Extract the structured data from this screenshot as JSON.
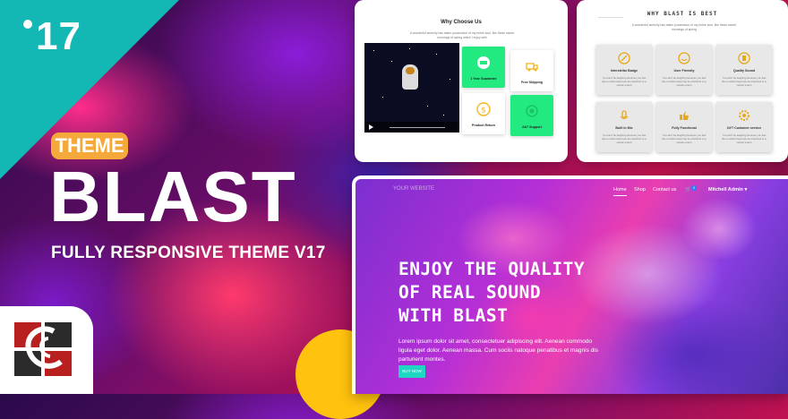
{
  "badge": {
    "version": "17"
  },
  "hero": {
    "theme_label": "THEME",
    "brand": "BLAST",
    "tagline": "FULLY RESPONSIVE THEME V17"
  },
  "colors": {
    "teal": "#13b7b3",
    "orange": "#f4a93a",
    "yellow": "#ffc20e",
    "green": "#22ea80"
  },
  "preview_why": {
    "title": "Why Choose Us",
    "subtitle": "A wonderful serenity has taken possession of my entire soul, like these sweet mornings of spring which I enjoy with",
    "features": [
      {
        "label": "1 Year Guarantee",
        "icon": "badge-icon"
      },
      {
        "label": "Free Shipping",
        "icon": "truck-icon"
      },
      {
        "label": "Product Return",
        "icon": "dollar-icon"
      },
      {
        "label": "24/7 Support",
        "icon": "headset-icon"
      }
    ]
  },
  "preview_best": {
    "title": "WHY BLAST IS BEST",
    "subtitle": "A wonderful serenity has taken possession of my entire soul, like these sweet mornings of spring",
    "tiles": [
      {
        "title": "Interstellar Badge",
        "icon": "rocket-icon"
      },
      {
        "title": "User Friendly",
        "icon": "smiley-icon"
      },
      {
        "title": "Quality Sound",
        "icon": "speaker-icon"
      },
      {
        "title": "Built in Mic",
        "icon": "mic-icon"
      },
      {
        "title": "Fully Functional",
        "icon": "thumbs-up-icon"
      },
      {
        "title": "24*7 Customer service",
        "icon": "gear-icon"
      }
    ],
    "tile_desc": "You can't be laughing because you feel like a rubber band can be stretched to a certain extent"
  },
  "preview_site": {
    "logo_text": "YOUR WEBSITE",
    "nav": {
      "home": "Home",
      "shop": "Shop",
      "contact": "Contact us",
      "cart_count": "0",
      "user": "Mitchell Admin"
    },
    "heading_lines": [
      "ENJOY THE QUALITY",
      "OF REAL SOUND",
      "WITH BLAST"
    ],
    "paragraph": "Lorem ipsum dolor sit amet, consectetuer adipiscing elit. Aenean commodo ligula eget dolor. Aenean massa. Cum sociis natoque penatibus et magnis dis parturient montes.",
    "cta": "BUY NOW"
  }
}
